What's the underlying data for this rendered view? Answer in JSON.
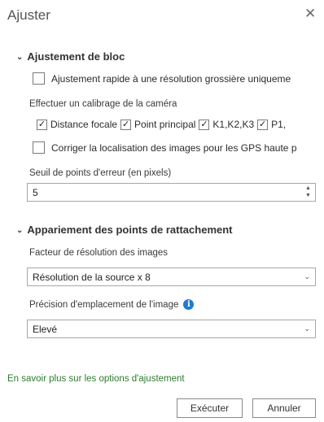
{
  "dialog": {
    "title": "Ajuster"
  },
  "block": {
    "heading": "Ajustement de bloc",
    "quick_adjust": {
      "label": "Ajustement rapide à une résolution grossière uniqueme",
      "checked": false
    },
    "calibration_label": "Effectuer un calibrage de la caméra",
    "calibration_options": [
      {
        "label": "Distance focale",
        "checked": true
      },
      {
        "label": "Point principal",
        "checked": true
      },
      {
        "label": "K1,K2,K3",
        "checked": true
      },
      {
        "label": "P1,",
        "checked": true
      }
    ],
    "gps_correction": {
      "label": "Corriger la localisation des images pour les GPS haute p",
      "checked": false
    },
    "error_threshold_label": "Seuil de points d'erreur (en pixels)",
    "error_threshold_value": "5"
  },
  "tiepoints": {
    "heading": "Appariement des points de rattachement",
    "resolution_label": "Facteur de résolution des images",
    "resolution_value": "Résolution de la source x 8",
    "precision_label": "Précision d'emplacement de l'image",
    "precision_value": "Elevé"
  },
  "footer": {
    "learn_more": "En savoir plus sur les options d'ajustement",
    "run_button": "Exécuter",
    "cancel_button": "Annuler"
  },
  "icons": {
    "close": "close-icon",
    "chevron": "chevron-down-icon",
    "info": "info-icon",
    "checkmark": "checkmark-icon"
  },
  "colors": {
    "link": "#2e7d2e",
    "info": "#1d7bd1"
  }
}
